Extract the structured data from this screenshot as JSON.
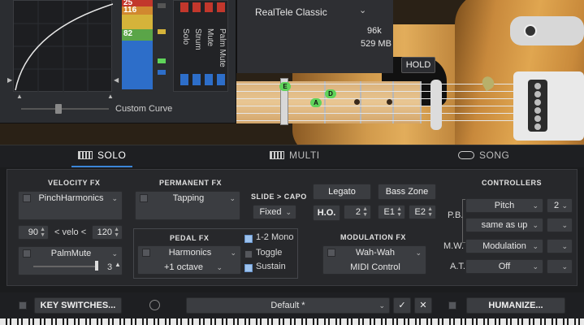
{
  "header": {
    "preset_name": "RealTele Classic",
    "sample_rate": "96k",
    "memory": "529 MB",
    "hold_label": "HOLD",
    "meter_values": [
      "25",
      "116",
      "82"
    ],
    "controls_labels": [
      "Solo",
      "Strum",
      "Mute",
      "Palm Mute"
    ],
    "custom_curve_label": "Custom Curve",
    "fretboard_notes": [
      "E",
      "D",
      "A"
    ]
  },
  "tabs": [
    {
      "label": "SOLO",
      "active": true
    },
    {
      "label": "MULTI",
      "active": false
    },
    {
      "label": "SONG",
      "active": false
    }
  ],
  "velocity_fx": {
    "title": "VELOCITY FX",
    "effect1": "PinchHarmonics",
    "velo_low": "90",
    "velo_label": "< velo <",
    "velo_high": "120",
    "effect2": "PalmMute",
    "effect2_value": "3"
  },
  "permanent_fx": {
    "title": "PERMANENT FX",
    "effect": "Tapping"
  },
  "slide_capo": {
    "title": "SLIDE > CAPO",
    "mode": "Fixed"
  },
  "pedal_fx": {
    "title": "PEDAL FX",
    "effect": "Harmonics",
    "interval": "+1 octave",
    "option1": "1-2 Mono",
    "option2": "Toggle",
    "option3": "Sustain"
  },
  "articulation": {
    "legato_label": "Legato",
    "bass_zone_label": "Bass Zone",
    "ho_label": "H.O.",
    "ho_value": "2",
    "zone_low": "E1",
    "zone_high": "E2"
  },
  "modulation_fx": {
    "title": "MODULATION FX",
    "effect": "Wah-Wah",
    "source": "MIDI Control"
  },
  "controllers": {
    "title": "CONTROLLERS",
    "pb_label": "P.B.",
    "pb_target": "Pitch",
    "pb_value": "2",
    "pb_release": "same as up",
    "mw_label": "M.W.",
    "mw_target": "Modulation",
    "at_label": "A.T.",
    "at_target": "Off"
  },
  "footer": {
    "key_switches_label": "KEY SWITCHES...",
    "preset_value": "Default *",
    "confirm_icon": "check-icon",
    "cancel_icon": "close-icon",
    "humanize_label": "HUMANIZE..."
  },
  "colors": {
    "accent": "#3c86d8",
    "note_green": "#5fd35a",
    "red": "#c2372c",
    "blue": "#2d6ec9"
  }
}
